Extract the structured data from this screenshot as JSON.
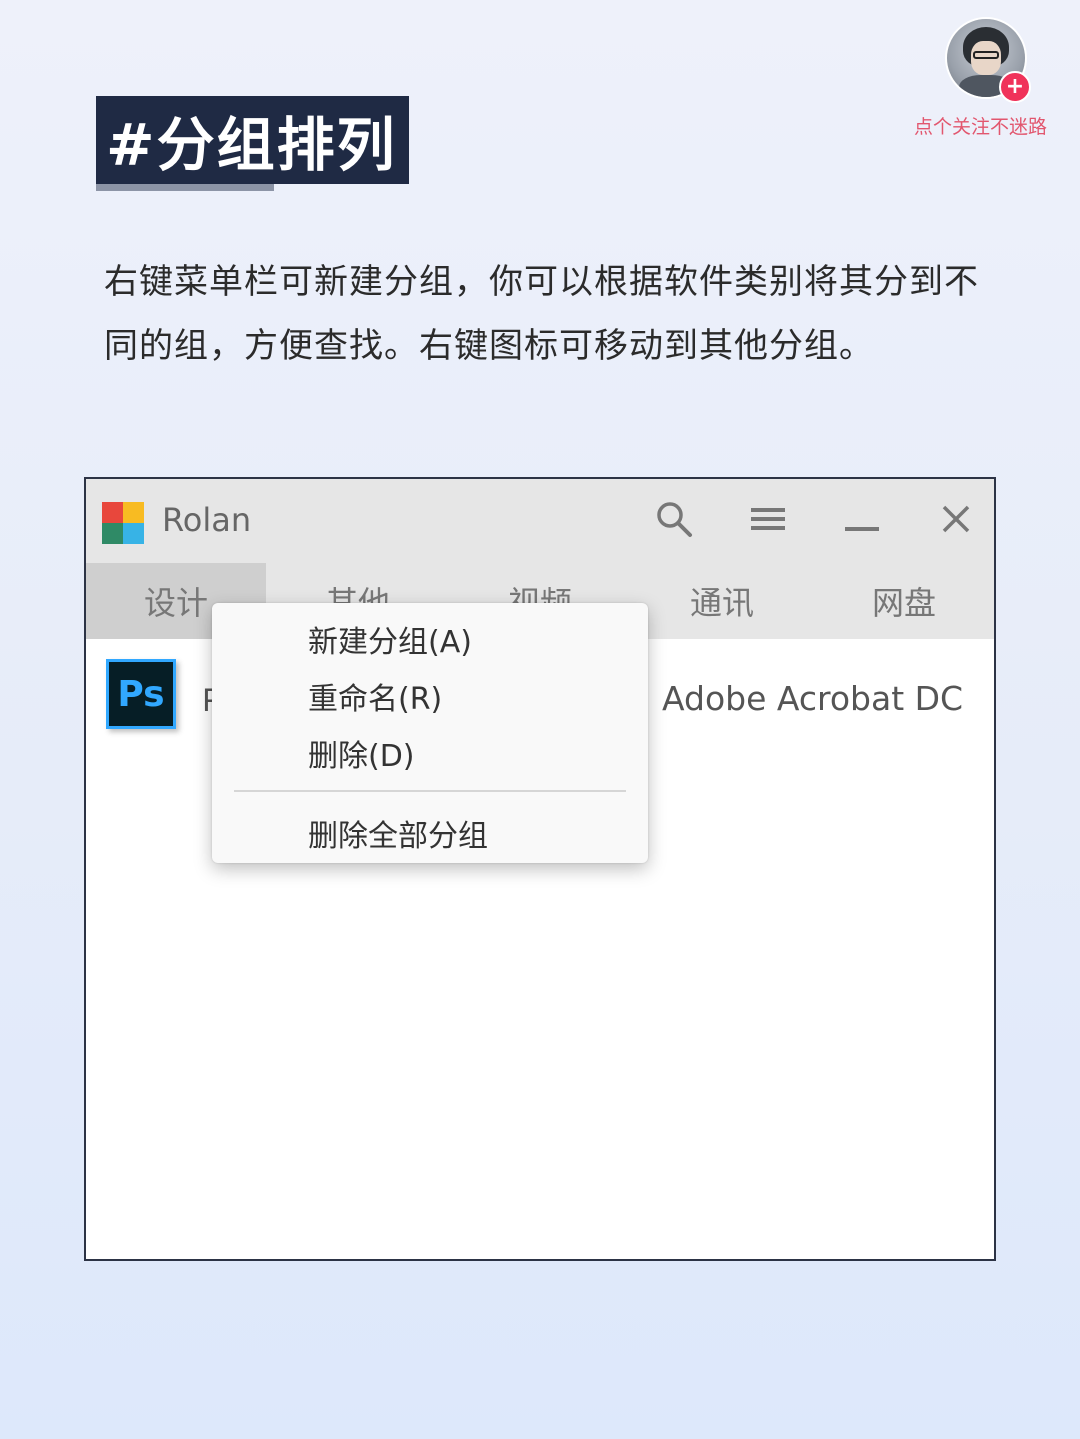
{
  "header": {
    "title": "#分组排列",
    "follow_text": "点个关注不迷路",
    "follow_plus": "+"
  },
  "description": "右键菜单栏可新建分组，你可以根据软件类别将其分到不同的组，方便查找。右键图标可移动到其他分组。",
  "window": {
    "app_name": "Rolan",
    "logo_colors": [
      "#e8473c",
      "#f8bb22",
      "#2f8a66",
      "#37b3e6"
    ],
    "icons": [
      "search-icon",
      "menu-icon",
      "minimize-icon",
      "close-icon"
    ],
    "tabs": [
      "设计",
      "其他",
      "视频",
      "通讯",
      "网盘"
    ],
    "active_tab": "设计",
    "apps": [
      {
        "icon_text": "Ps",
        "label": "P"
      },
      {
        "label": "Adobe Acrobat DC"
      }
    ]
  },
  "context_menu": {
    "items": [
      "新建分组(A)",
      "重命名(R)",
      "删除(D)",
      "删除全部分组"
    ]
  },
  "colors": {
    "title_bg": "#1f2a44",
    "accent_pink": "#e2566e",
    "ps_blue": "#31a8ff"
  }
}
